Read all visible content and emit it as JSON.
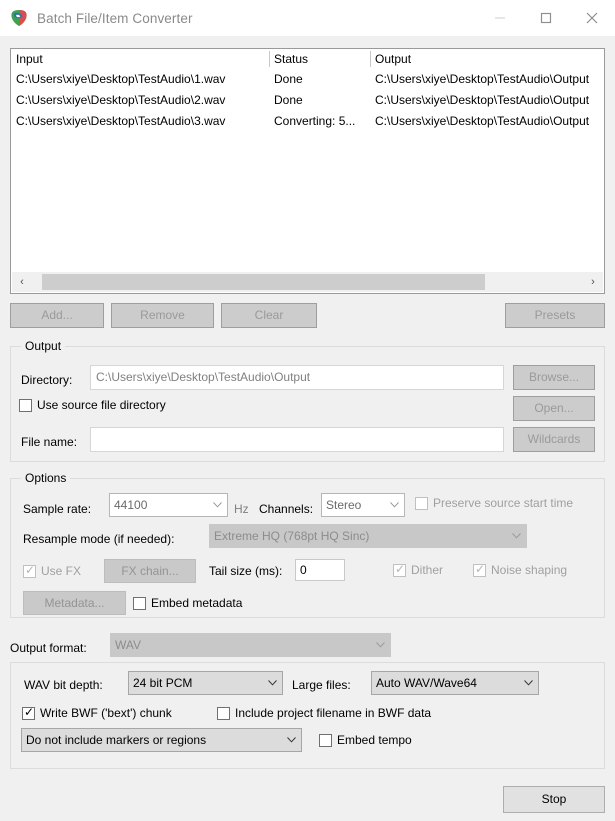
{
  "window": {
    "title": "Batch File/Item Converter",
    "icon": "reaper-logo-icon",
    "minimize": "–",
    "maximize": "□",
    "close": "✕"
  },
  "file_list": {
    "columns": [
      "Input",
      "Status",
      "Output"
    ],
    "rows": [
      {
        "input": "C:\\Users\\xiye\\Desktop\\TestAudio\\1.wav",
        "status": "Done",
        "output": "C:\\Users\\xiye\\Desktop\\TestAudio\\Output"
      },
      {
        "input": "C:\\Users\\xiye\\Desktop\\TestAudio\\2.wav",
        "status": "Done",
        "output": "C:\\Users\\xiye\\Desktop\\TestAudio\\Output"
      },
      {
        "input": "C:\\Users\\xiye\\Desktop\\TestAudio\\3.wav",
        "status": "Converting: 5...",
        "output": "C:\\Users\\xiye\\Desktop\\TestAudio\\Output"
      }
    ],
    "scroll_left_arrow": "‹",
    "scroll_right_arrow": "›"
  },
  "toolbar": {
    "add": "Add...",
    "remove": "Remove",
    "clear": "Clear",
    "presets": "Presets"
  },
  "output_group": {
    "title": "Output",
    "directory_label": "Directory:",
    "directory_value": "C:\\Users\\xiye\\Desktop\\TestAudio\\Output",
    "browse": "Browse...",
    "use_source_dir_label": "Use source file directory",
    "use_source_dir_checked": false,
    "open": "Open...",
    "filename_label": "File name:",
    "filename_value": "",
    "wildcards": "Wildcards"
  },
  "options_group": {
    "title": "Options",
    "sample_rate_label": "Sample rate:",
    "sample_rate_value": "44100",
    "hz_label": "Hz",
    "channels_label": "Channels:",
    "channels_value": "Stereo",
    "preserve_start_time_label": "Preserve source start time",
    "preserve_start_time_checked": false,
    "resample_mode_label": "Resample mode (if needed):",
    "resample_mode_value": "Extreme HQ (768pt HQ Sinc)",
    "use_fx_label": "Use FX",
    "use_fx_checked": true,
    "fx_chain": "FX chain...",
    "tail_size_label": "Tail size (ms):",
    "tail_size_value": "0",
    "dither_label": "Dither",
    "dither_checked": true,
    "noise_shaping_label": "Noise shaping",
    "noise_shaping_checked": true,
    "metadata": "Metadata...",
    "embed_metadata_label": "Embed metadata",
    "embed_metadata_checked": false
  },
  "format": {
    "output_format_label": "Output format:",
    "output_format_value": "WAV",
    "wav_bit_depth_label": "WAV bit depth:",
    "wav_bit_depth_value": "24 bit PCM",
    "large_files_label": "Large files:",
    "large_files_value": "Auto WAV/Wave64",
    "write_bwf_label": "Write BWF ('bext') chunk",
    "write_bwf_checked": true,
    "include_project_filename_label": "Include project filename in BWF data",
    "include_project_filename_checked": false,
    "markers_value": "Do not include markers or regions",
    "embed_tempo_label": "Embed tempo",
    "embed_tempo_checked": false
  },
  "footer": {
    "stop": "Stop"
  },
  "colors": {
    "window_bg": "#f0f0f0",
    "titlebar_bg": "#ffffff",
    "disabled_text": "#a0a0a0",
    "list_bg": "#ffffff"
  }
}
